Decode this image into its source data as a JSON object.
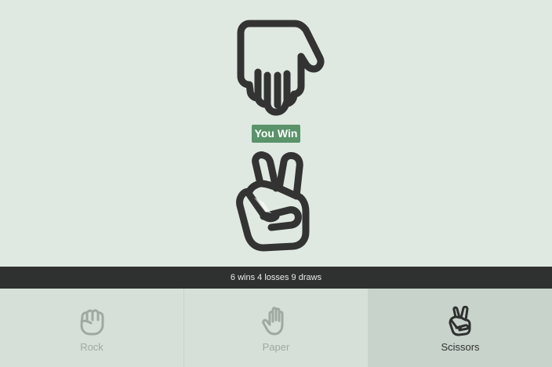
{
  "game": {
    "result_label": "You Win",
    "opponent_choice": "paper",
    "player_choice": "scissors"
  },
  "score": {
    "summary": "6 wins 4 losses 9 draws"
  },
  "choices": [
    {
      "label": "Rock",
      "icon": "rock-fist-icon",
      "selected": false
    },
    {
      "label": "Paper",
      "icon": "paper-hand-icon",
      "selected": false
    },
    {
      "label": "Scissors",
      "icon": "scissors-hand-icon",
      "selected": true
    }
  ],
  "colors": {
    "background": "#dfe9e2",
    "result_badge": "#5a9369",
    "score_bar": "#2f3130",
    "hand_stroke": "#333333",
    "inactive_icon": "#9ea9a1"
  }
}
